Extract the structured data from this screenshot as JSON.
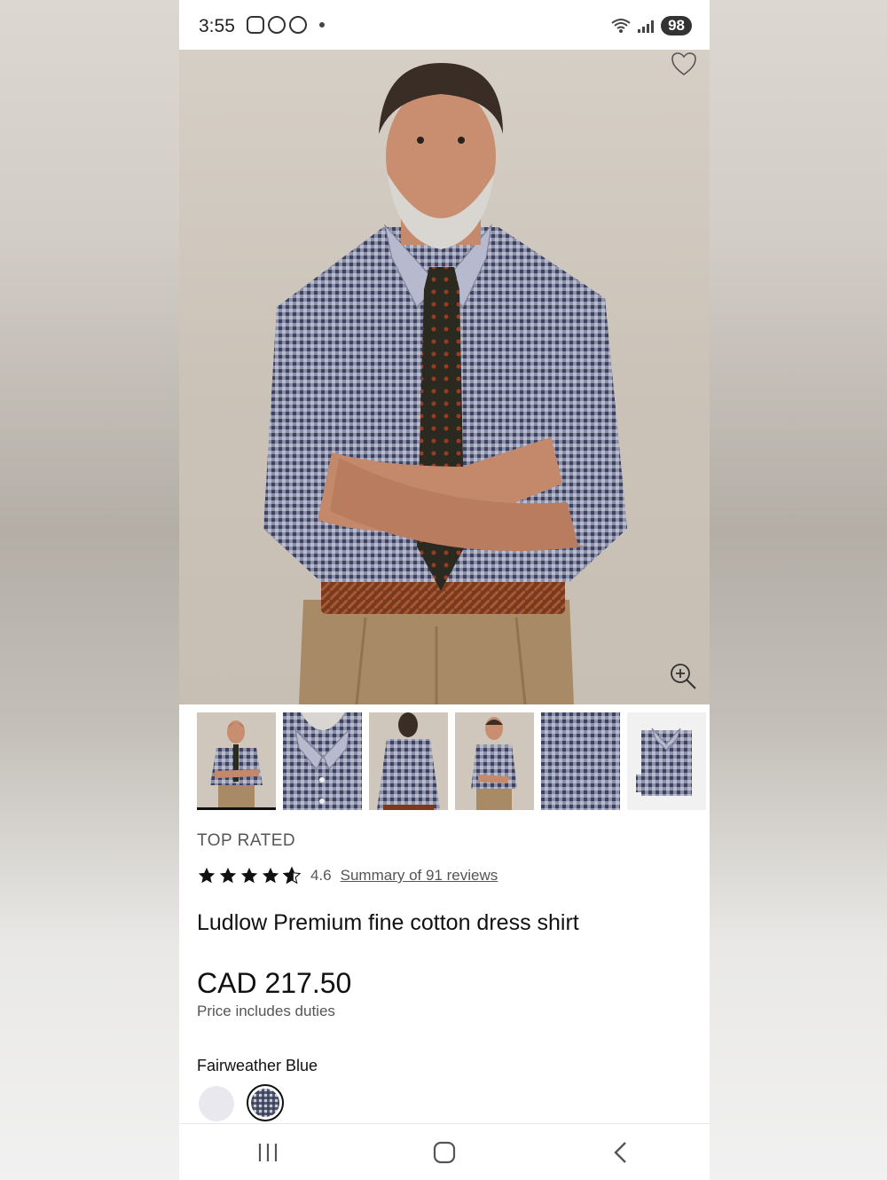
{
  "status_bar": {
    "time": "3:55",
    "battery": "98"
  },
  "hero": {
    "favorite_icon": "heart-outline-icon",
    "zoom_icon": "zoom-in-icon"
  },
  "thumbnails": [
    {
      "label": "model-front"
    },
    {
      "label": "collar-detail"
    },
    {
      "label": "back-view"
    },
    {
      "label": "side-view"
    },
    {
      "label": "fabric-swatch"
    },
    {
      "label": "folded-shirt"
    }
  ],
  "product": {
    "badge": "TOP RATED",
    "rating": "4.6",
    "rating_value": 4.6,
    "reviews_link": "Summary of 91 reviews",
    "name": "Ludlow Premium fine cotton dress shirt",
    "price": "CAD 217.50",
    "price_note": "Price includes duties",
    "color_name": "Fairweather Blue"
  },
  "colors": {
    "accent": "#111111",
    "muted_text": "#555555"
  }
}
